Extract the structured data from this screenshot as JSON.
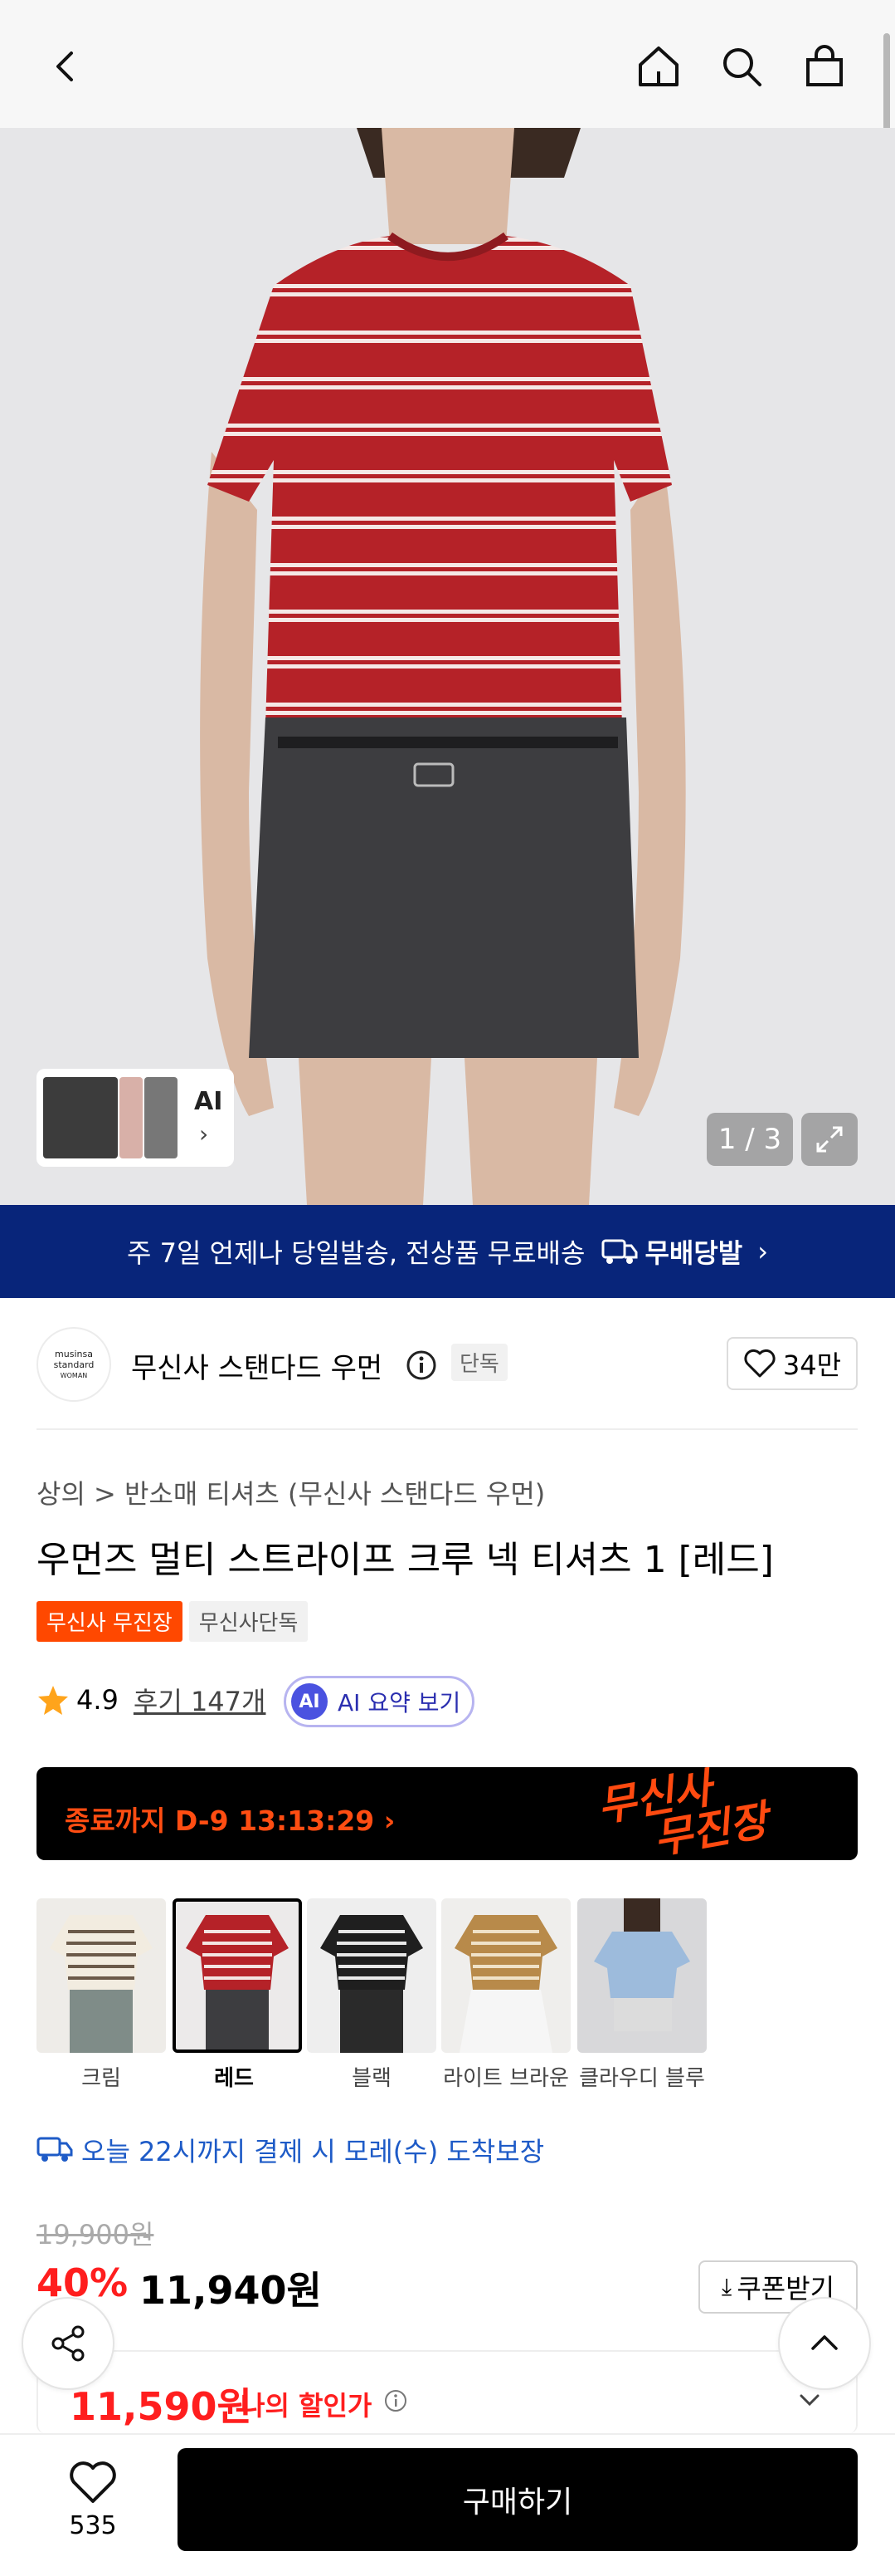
{
  "nav": {
    "back_icon": "chevron-left-icon",
    "home_icon": "home-icon",
    "search_icon": "search-icon",
    "cart_icon": "shopping-bag-icon"
  },
  "gallery": {
    "thumb_ai_label": "AI",
    "pager": "1 / 3"
  },
  "banner": {
    "text": "주 7일 언제나 당일발송, 전상품 무료배송",
    "badge": "무배당발",
    "chevron": "›"
  },
  "brand": {
    "logo_line1": "musinsa",
    "logo_line2": "standard",
    "logo_line3": "WOMAN",
    "name": "무신사 스탠다드 우먼",
    "exclusive_tag": "단독",
    "likes": "34만"
  },
  "product": {
    "breadcrumb": "상의 > 반소매 티셔츠 (무신사 스탠다드 우먼)",
    "title": "우먼즈 멀티 스트라이프 크루 넥 티셔츠 1 [레드]",
    "tags": [
      "무신사 무진장",
      "무신사단독"
    ],
    "rating": "4.9",
    "reviews": "후기 147개",
    "ai_summary": "AI 요약 보기",
    "ai_badge": "AI"
  },
  "countdown": {
    "text": "종료까지 D-9 13:13:29 ›",
    "logo_line1": "무신사",
    "logo_line2": "무진장"
  },
  "colors": [
    {
      "label": "크림",
      "selected": false
    },
    {
      "label": "레드",
      "selected": true
    },
    {
      "label": "블랙",
      "selected": false
    },
    {
      "label": "라이트 브라운",
      "selected": false
    },
    {
      "label": "클라우디 블루",
      "selected": false
    }
  ],
  "delivery": {
    "text": "오늘 22시까지 결제 시 모레(수) 도착보장"
  },
  "price": {
    "original": "19,900원",
    "discount": "40%",
    "sale": "11,940원",
    "coupon": "쿠폰받기",
    "my_price": "11,590원",
    "my_label": "나의 할인가"
  },
  "bottom": {
    "wish_count": "535",
    "buy_label": "구매하기"
  },
  "theme": {
    "banner_blue": "#08257a",
    "sale_red": "#ff1e1e",
    "orange": "#ff4800",
    "delivery_blue": "#1e5bc7"
  }
}
